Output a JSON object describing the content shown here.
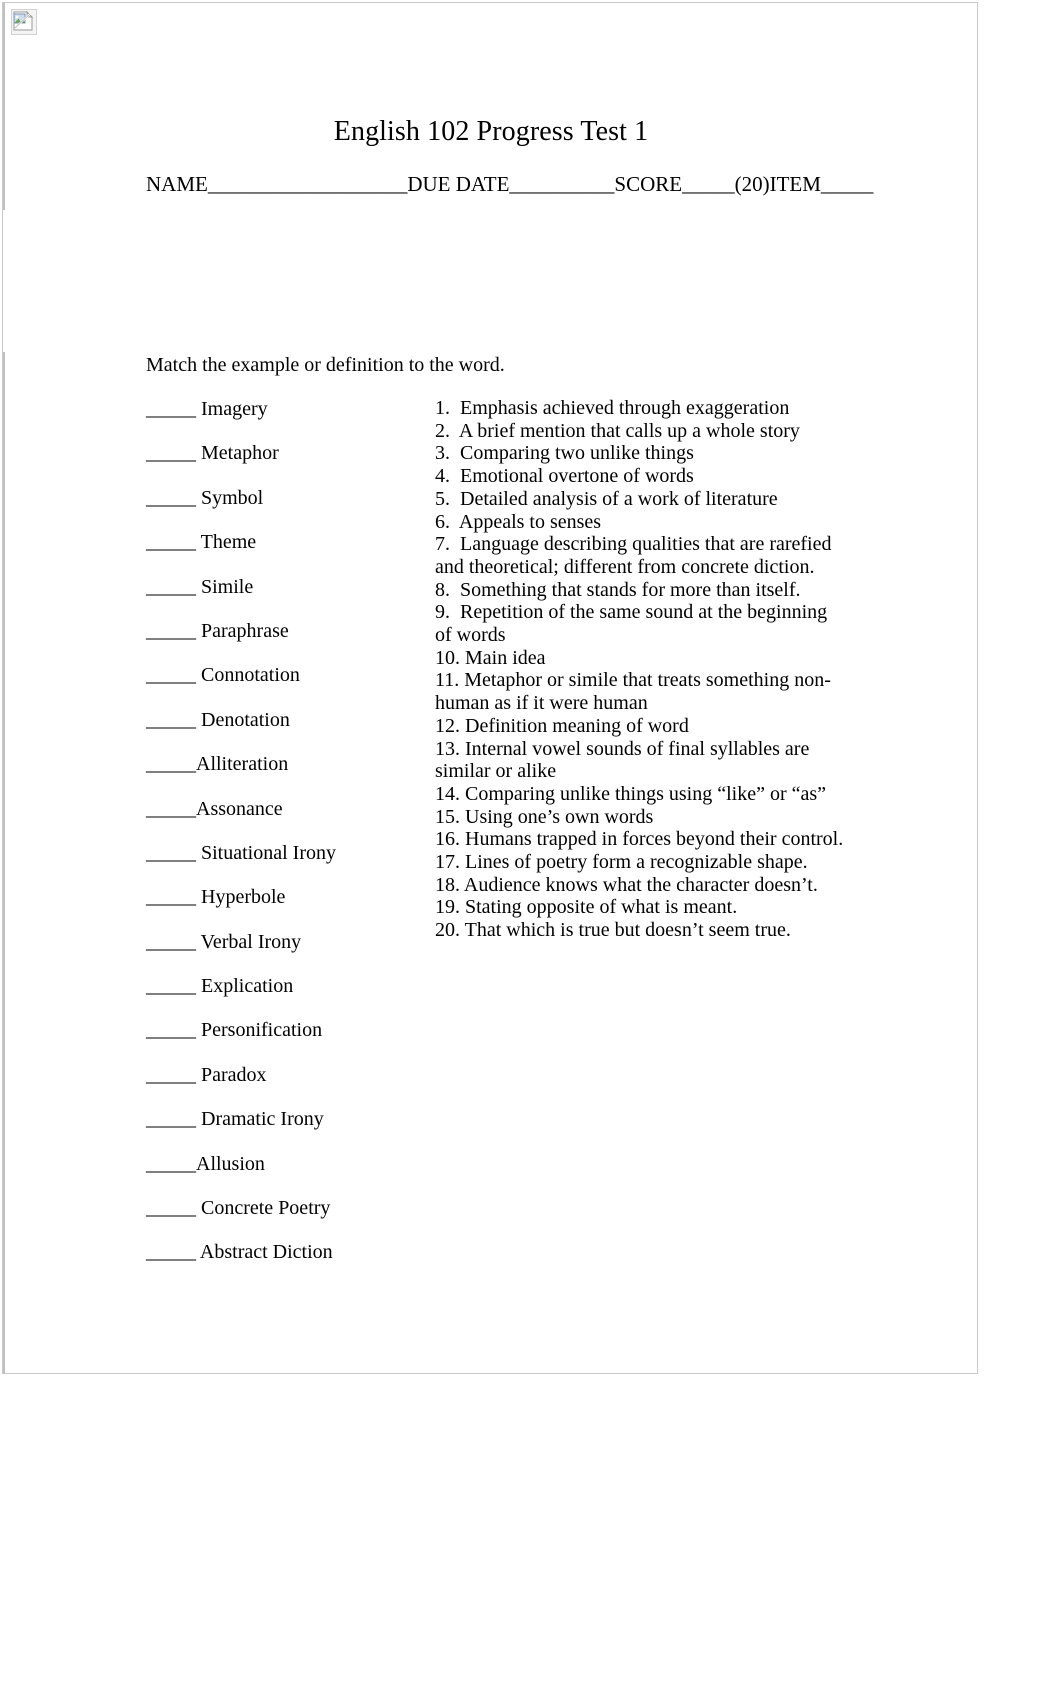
{
  "document": {
    "title": "English 102 Progress Test 1",
    "header_fields": "NAME___________________DUE DATE__________SCORE_____(20)ITEM_____",
    "instruction": "Match the example or definition to the word.",
    "broken_image_alt": "broken-image-placeholder"
  },
  "terms": [
    {
      "blank": "_____ ",
      "label": "Imagery"
    },
    {
      "blank": "_____ ",
      "label": "Metaphor"
    },
    {
      "blank": "_____ ",
      "label": "Symbol"
    },
    {
      "blank": "_____ ",
      "label": "Theme"
    },
    {
      "blank": "_____ ",
      "label": "Simile"
    },
    {
      "blank": "_____ ",
      "label": "Paraphrase"
    },
    {
      "blank": "_____ ",
      "label": "Connotation"
    },
    {
      "blank": "_____ ",
      "label": "Denotation"
    },
    {
      "blank": "_____",
      "label": "Alliteration"
    },
    {
      "blank": "_____",
      "label": "Assonance"
    },
    {
      "blank": "_____ ",
      "label": "Situational Irony"
    },
    {
      "blank": "_____ ",
      "label": "Hyperbole"
    },
    {
      "blank": "_____ ",
      "label": "Verbal Irony"
    },
    {
      "blank": "_____ ",
      "label": "Explication"
    },
    {
      "blank": "_____ ",
      "label": "Personification"
    },
    {
      "blank": "_____ ",
      "label": "Paradox"
    },
    {
      "blank": "_____ ",
      "label": "Dramatic Irony"
    },
    {
      "blank": "_____",
      "label": "Allusion"
    },
    {
      "blank": "_____ ",
      "label": "Concrete Poetry"
    },
    {
      "blank": "_____ ",
      "label": "Abstract Diction"
    }
  ],
  "definitions": [
    {
      "number": "1.",
      "text": "Emphasis achieved through exaggeration"
    },
    {
      "number": "2.",
      "text": "A brief mention that calls up a whole story"
    },
    {
      "number": "3.",
      "text": "Comparing two unlike things"
    },
    {
      "number": "4.",
      "text": "Emotional overtone of words"
    },
    {
      "number": "5.",
      "text": "Detailed analysis of a work of literature"
    },
    {
      "number": "6.",
      "text": "Appeals to senses"
    },
    {
      "number": "7.",
      "text": "Language describing qualities that are rarefied and theoretical; different from concrete diction."
    },
    {
      "number": "8.",
      "text": "Something that stands for more than itself."
    },
    {
      "number": "9.",
      "text": "Repetition of the same sound at the beginning of words"
    },
    {
      "number": "10.",
      "text": "Main idea"
    },
    {
      "number": "11.",
      "text": "Metaphor or simile that treats something non-human as if it were human"
    },
    {
      "number": "12.",
      "text": "Definition meaning of word"
    },
    {
      "number": "13.",
      "text": "Internal vowel sounds of final syllables are similar or alike"
    },
    {
      "number": "14.",
      "text": "Comparing unlike things using “like” or “as”"
    },
    {
      "number": "15.",
      "text": "Using one’s own words"
    },
    {
      "number": "16.",
      "text": "Humans trapped in forces beyond their control."
    },
    {
      "number": "17.",
      "text": "Lines of poetry form a recognizable shape."
    },
    {
      "number": "18.",
      "text": "Audience knows what the character doesn’t."
    },
    {
      "number": "19.",
      "text": "Stating opposite of what is meant."
    },
    {
      "number": "20.",
      "text": "That which is true but doesn’t seem true."
    }
  ],
  "colors": {
    "page_border": "#c8c8c8",
    "section_rule": "#c0c0c0",
    "text": "#000000",
    "background": "#ffffff"
  }
}
